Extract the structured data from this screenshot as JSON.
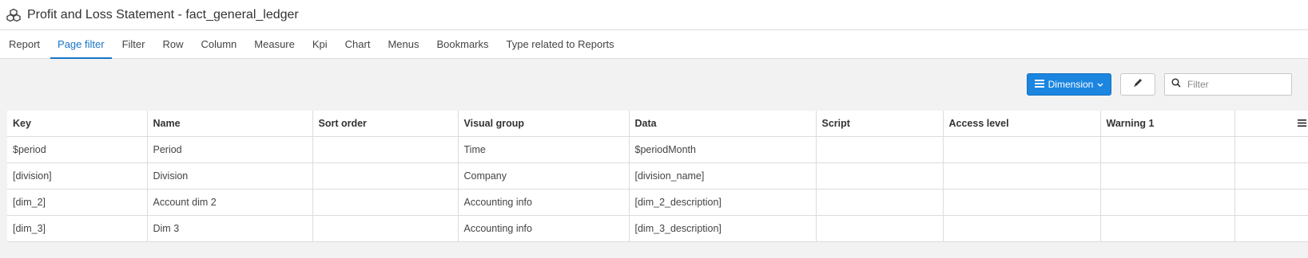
{
  "title": "Profit and Loss Statement - fact_general_ledger",
  "tabs": [
    {
      "label": "Report"
    },
    {
      "label": "Page filter"
    },
    {
      "label": "Filter"
    },
    {
      "label": "Row"
    },
    {
      "label": "Column"
    },
    {
      "label": "Measure"
    },
    {
      "label": "Kpi"
    },
    {
      "label": "Chart"
    },
    {
      "label": "Menus"
    },
    {
      "label": "Bookmarks"
    },
    {
      "label": "Type related to Reports"
    }
  ],
  "active_tab": "Page filter",
  "toolbar": {
    "dimension_button": "Dimension",
    "filter_placeholder": "Filter"
  },
  "table": {
    "columns": [
      "Key",
      "Name",
      "Sort order",
      "Visual group",
      "Data",
      "Script",
      "Access level",
      "Warning 1"
    ],
    "rows": [
      [
        "$period",
        "Period",
        "",
        "Time",
        "$periodMonth",
        "",
        "",
        ""
      ],
      [
        "[division]",
        "Division",
        "",
        "Company",
        "[division_name]",
        "",
        "",
        ""
      ],
      [
        "[dim_2]",
        "Account dim 2",
        "",
        "Accounting info",
        "[dim_2_description]",
        "",
        "",
        ""
      ],
      [
        "[dim_3]",
        "Dim 3",
        "",
        "Accounting info",
        "[dim_3_description]",
        "",
        "",
        ""
      ]
    ]
  },
  "colors": {
    "accent": "#1a73c6",
    "button": "#1b85e0",
    "background": "#f2f2f2"
  },
  "icons": {
    "app": "cubes-icon",
    "dimension": "list-icon",
    "dropdown": "chevron-down-icon",
    "edit": "pencil-icon",
    "filter": "search-icon",
    "column_menu": "hamburger-menu-icon"
  }
}
